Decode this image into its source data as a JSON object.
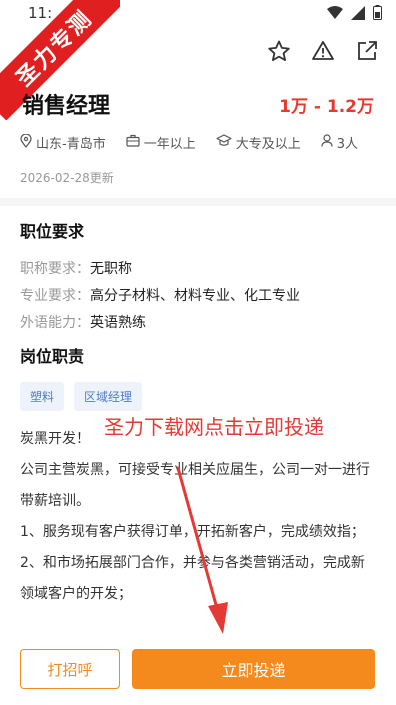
{
  "status_bar": {
    "time": "11:"
  },
  "watermark": {
    "text": "圣力专测"
  },
  "job": {
    "title": "销售经理",
    "salary": "1万 - 1.2万",
    "location": "山东-青岛市",
    "experience": "一年以上",
    "education": "大专及以上",
    "headcount": "3人",
    "updated": "2026-02-28更新"
  },
  "requirements": {
    "heading": "职位要求",
    "rows": [
      {
        "label": "职称要求：",
        "value": "无职称"
      },
      {
        "label": "专业要求：",
        "value": "高分子材料、材料专业、化工专业"
      },
      {
        "label": "外语能力：",
        "value": "英语熟练"
      }
    ]
  },
  "duties": {
    "heading": "岗位职责",
    "tags": [
      "塑料",
      "区域经理"
    ],
    "paragraphs": [
      "炭黑开发！",
      "公司主营炭黑，可接受专业相关应届生，公司一对一进行带薪培训。",
      "1、服务现有客户获得订单，开拓新客户，完成绩效指；",
      "2、和市场拓展部门合作，并参与各类营销活动，完成新领域客户的开发；"
    ]
  },
  "overlay": {
    "text": "圣力下载网点击立即投递"
  },
  "actions": {
    "call_label": "打招呼",
    "apply_label": "立即投递"
  },
  "colors": {
    "accent": "#f48a1e",
    "salary": "#e8392e",
    "tag_bg": "#eef3fb",
    "tag_text": "#4f7ccd"
  }
}
